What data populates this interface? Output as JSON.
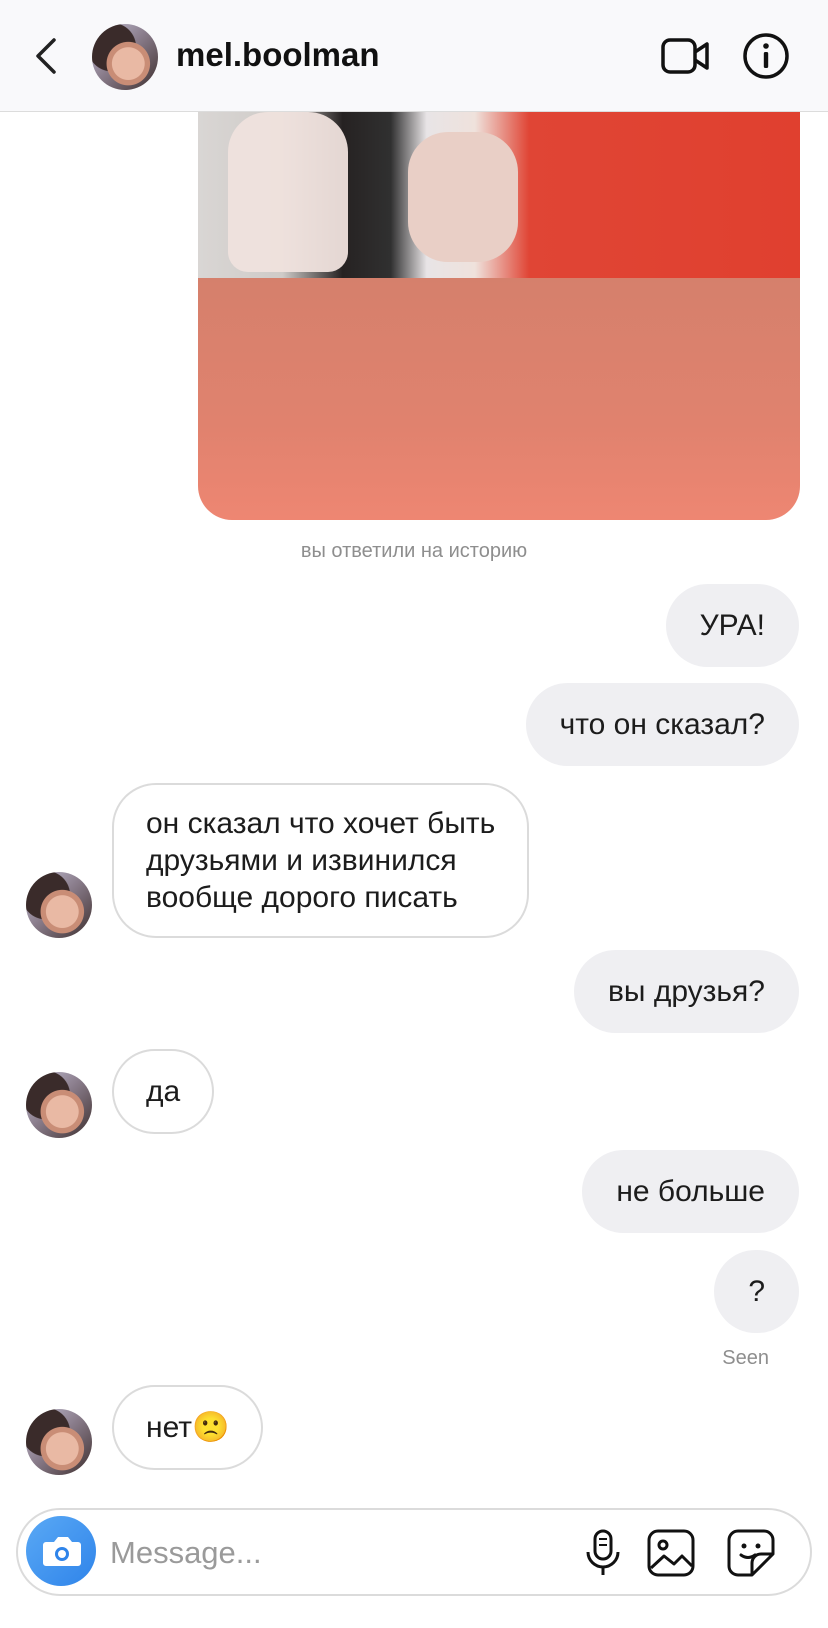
{
  "header": {
    "username": "mel.boolman"
  },
  "story": {
    "reply_note": "вы ответили на историю"
  },
  "messages": [
    {
      "from": "me",
      "text": "УРА!"
    },
    {
      "from": "me",
      "text": "что он сказал?"
    },
    {
      "from": "them",
      "lines": [
        "он сказал что хочет быть",
        "друзьями и извинился",
        "вообще дорого писать"
      ]
    },
    {
      "from": "me",
      "text": "вы друзья?"
    },
    {
      "from": "them",
      "text": "да"
    },
    {
      "from": "me",
      "text": "не больше"
    },
    {
      "from": "me",
      "text": "?"
    },
    {
      "from": "them",
      "text": "нет",
      "emoji": "🙁"
    }
  ],
  "seen_label": "Seen",
  "composer": {
    "placeholder": "Message..."
  },
  "icons": {
    "back": "chevron-left-icon",
    "video": "video-camera-icon",
    "info": "info-icon",
    "camera": "camera-icon",
    "mic": "microphone-icon",
    "gallery": "gallery-icon",
    "sticker": "sticker-icon"
  },
  "colors": {
    "sent_bubble": "#efeff2",
    "received_border": "#dbdbdb",
    "story_panel": "#e0826e",
    "camera_button": "#2f84ea"
  }
}
